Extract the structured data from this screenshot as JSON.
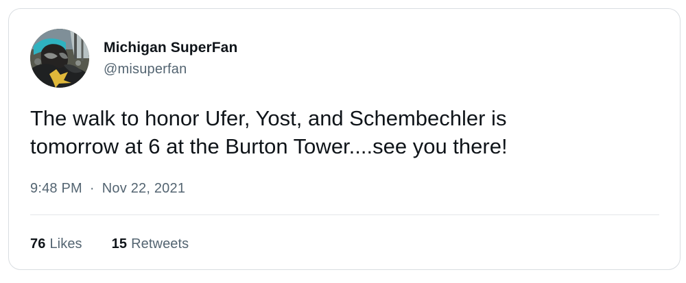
{
  "tweet": {
    "author": {
      "display_name": "Michigan SuperFan",
      "handle": "@misuperfan"
    },
    "text": "The walk to honor Ufer, Yost, and Schembechler is\ntomorrow at 6 at the Burton Tower....see you there!",
    "time": "9:48 PM",
    "separator": "·",
    "date": "Nov 22, 2021",
    "stats": {
      "likes": {
        "count": "76",
        "label": "Likes"
      },
      "retweets": {
        "count": "15",
        "label": "Retweets"
      }
    }
  },
  "colors": {
    "text_primary": "#0f1419",
    "text_secondary": "#536471",
    "border": "#d9dde1",
    "divider": "#e3e6e9"
  }
}
